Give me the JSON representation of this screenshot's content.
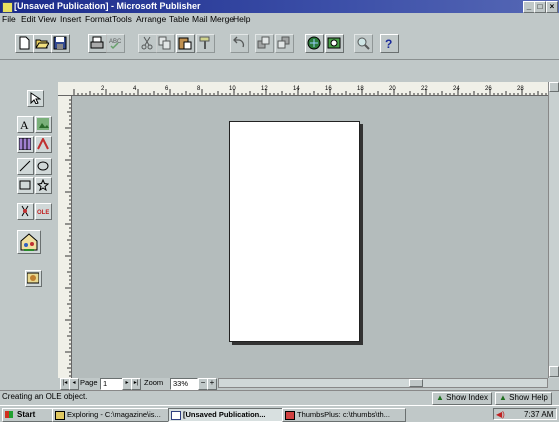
{
  "window": {
    "title": "[Unsaved Publication] - Microsoft Publisher",
    "minimize_glyph": "_",
    "maximize_glyph": "□",
    "close_glyph": "×"
  },
  "menu": [
    "File",
    "Edit",
    "View",
    "Insert",
    "Format",
    "Tools",
    "Arrange",
    "Table",
    "Mail Merge",
    "Help"
  ],
  "toolbar_icons": [
    "new-icon",
    "open-icon",
    "save-icon",
    "print-icon",
    "spelling-icon",
    "cut-icon",
    "copy-icon",
    "paste-icon",
    "format-painter-icon",
    "undo-icon",
    "bring-to-front-icon",
    "send-to-back-icon",
    "page-wizard-icon",
    "design-gallery-icon",
    "zoom-icon",
    "help-icon"
  ],
  "toolbox_icons": [
    "pointer-icon",
    "text-frame-icon",
    "picture-frame-icon",
    "table-frame-icon",
    "wordart-frame-icon",
    "line-icon",
    "oval-icon",
    "box-icon",
    "custom-shape-icon",
    "ole-object-icon",
    "clip-art-icon",
    "page-wizard-frame-icon",
    "design-gallery-object-icon"
  ],
  "hruler": {
    "labels": [
      "2",
      "4",
      "6",
      "8",
      "10",
      "12",
      "14",
      "16",
      "18",
      "20",
      "22",
      "24",
      "26",
      "28",
      "30"
    ]
  },
  "nav": {
    "page_label": "Page",
    "page_value": "1",
    "zoom_label": "Zoom",
    "zoom_value": "33%",
    "zoom_minus": "−",
    "zoom_plus": "+"
  },
  "status": {
    "text": "Creating an OLE object.",
    "show_index": "Show Index",
    "show_help": "Show Help"
  },
  "taskbar": {
    "start": "Start",
    "tasks": [
      {
        "label": "Exploring - C:\\magazine\\is..."
      },
      {
        "label": "[Unsaved Publication..."
      },
      {
        "label": "ThumbsPlus: c:\\thumbs\\th..."
      }
    ],
    "clock": "7:37 AM"
  },
  "colors": {
    "titlebar": "#1a2a8a",
    "face": "#c0c8c8",
    "workspace": "#b4bcbc"
  }
}
